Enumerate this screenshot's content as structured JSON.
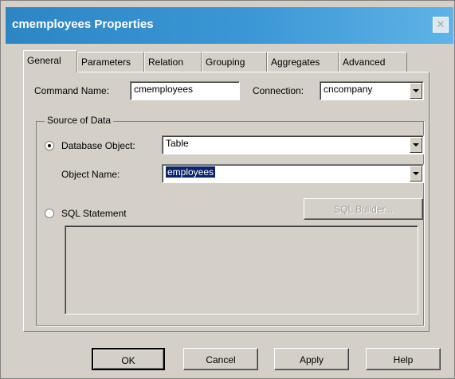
{
  "window": {
    "title": "cmemployees Properties"
  },
  "tabs": [
    {
      "label": "General",
      "active": true
    },
    {
      "label": "Parameters",
      "active": false
    },
    {
      "label": "Relation",
      "active": false
    },
    {
      "label": "Grouping",
      "active": false
    },
    {
      "label": "Aggregates",
      "active": false
    },
    {
      "label": "Advanced",
      "active": false
    }
  ],
  "general": {
    "command_name_label": "Command Name:",
    "command_name_value": "cmemployees",
    "connection_label": "Connection:",
    "connection_value": "cncompany",
    "source_group_label": "Source of Data",
    "db_object_label": "Database Object:",
    "db_object_value": "Table",
    "object_name_label": "Object Name:",
    "object_name_value": "employees",
    "sql_label": "SQL Statement",
    "sql_builder_label": "SQL Builder...",
    "sql_text": ""
  },
  "buttons": {
    "ok": "OK",
    "cancel": "Cancel",
    "apply": "Apply",
    "help": "Help"
  }
}
